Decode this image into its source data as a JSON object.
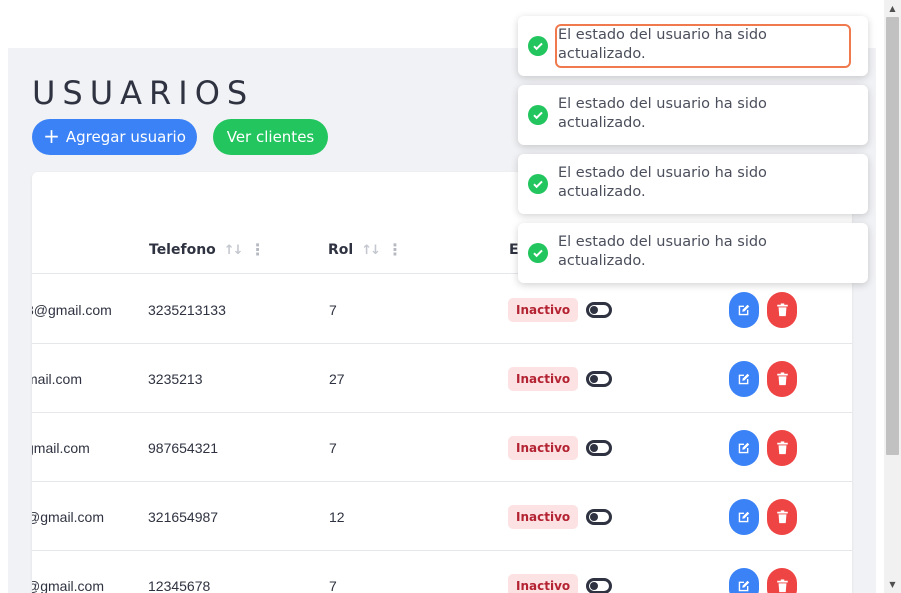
{
  "page": {
    "title": "USUARIOS",
    "add_button": "Agregar usuario",
    "clients_button": "Ver clientes"
  },
  "table": {
    "headers": [
      {
        "label": "Telefono"
      },
      {
        "label": "Rol"
      },
      {
        "label": "E"
      }
    ],
    "rows": [
      {
        "email": "3@gmail.com",
        "telefono": "3235213133",
        "rol": "7",
        "estado": "Inactivo"
      },
      {
        "email": "mail.com",
        "telefono": "3235213",
        "rol": "27",
        "estado": "Inactivo"
      },
      {
        "email": "gmail.com",
        "telefono": "987654321",
        "rol": "7",
        "estado": "Inactivo"
      },
      {
        "email": "@gmail.com",
        "telefono": "321654987",
        "rol": "12",
        "estado": "Inactivo"
      },
      {
        "email": "@gmail.com",
        "telefono": "12345678",
        "rol": "7",
        "estado": "Inactivo"
      }
    ]
  },
  "toasts": [
    {
      "message": "El estado del usuario ha sido actualizado."
    },
    {
      "message": "El estado del usuario ha sido actualizado."
    },
    {
      "message": "El estado del usuario ha sido actualizado."
    },
    {
      "message": "El estado del usuario ha sido actualizado."
    }
  ],
  "colors": {
    "primary": "#3b82f6",
    "success": "#22c55e",
    "danger": "#ef4444",
    "badge_bg": "#fde2e4",
    "badge_text": "#b42332",
    "focus_outline": "#f07a4e"
  },
  "icons": {
    "add": "plus-icon",
    "sort": "sort-icon",
    "menu": "kebab-icon",
    "edit": "pencil-square-icon",
    "delete": "trash-icon",
    "toast": "check-circle-icon"
  }
}
